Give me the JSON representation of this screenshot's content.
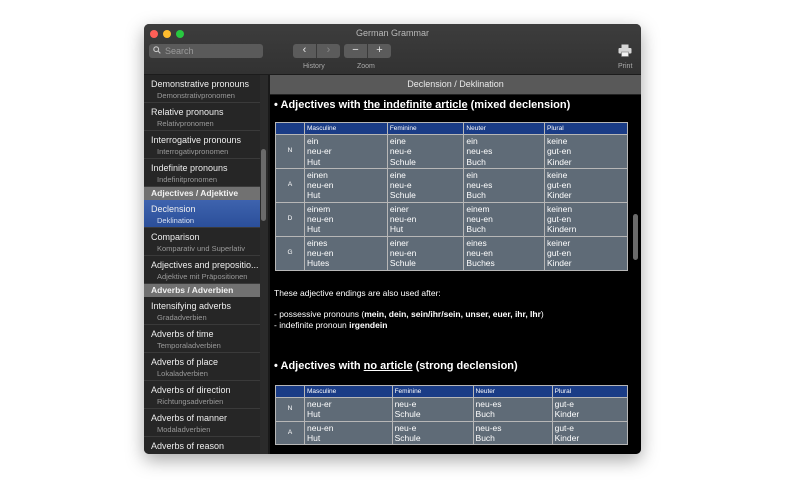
{
  "window": {
    "title": "German Grammar",
    "toolbar": {
      "search_placeholder": "Search",
      "history_label": "History",
      "zoom_label": "Zoom",
      "print_label": "Print",
      "back_glyph": "‹",
      "forward_glyph": "›",
      "zoom_out_glyph": "−",
      "zoom_in_glyph": "+"
    }
  },
  "sidebar": {
    "items": [
      {
        "type": "item",
        "title": "Demonstrative pronouns",
        "subtitle": "Demonstrativpronomen"
      },
      {
        "type": "item",
        "title": "Relative pronouns",
        "subtitle": "Relativpronomen"
      },
      {
        "type": "item",
        "title": "Interrogative pronouns",
        "subtitle": "Interrogativpronomen"
      },
      {
        "type": "item",
        "title": "Indefinite pronouns",
        "subtitle": "Indefinitpronomen"
      },
      {
        "type": "header",
        "title": "Adjectives / Adjektive"
      },
      {
        "type": "item",
        "title": "Declension",
        "subtitle": "Deklination",
        "selected": true
      },
      {
        "type": "item",
        "title": "Comparison",
        "subtitle": "Komparativ und Superlativ"
      },
      {
        "type": "item",
        "title": "Adjectives and prepositio...",
        "subtitle": "Adjektive mit Präpositionen"
      },
      {
        "type": "header",
        "title": "Adverbs / Adverbien"
      },
      {
        "type": "item",
        "title": "Intensifying adverbs",
        "subtitle": "Gradadverbien"
      },
      {
        "type": "item",
        "title": "Adverbs of time",
        "subtitle": "Temporaladverbien"
      },
      {
        "type": "item",
        "title": "Adverbs of place",
        "subtitle": "Lokaladverbien"
      },
      {
        "type": "item",
        "title": "Adverbs of direction",
        "subtitle": "Richtungsadverbien"
      },
      {
        "type": "item",
        "title": "Adverbs of manner",
        "subtitle": "Modaladverbien"
      },
      {
        "type": "item",
        "title": "Adverbs of reason",
        "subtitle": ""
      }
    ]
  },
  "content": {
    "header": "Declension / Deklination",
    "section1": {
      "bullet": "•",
      "pre": "Adjectives with ",
      "underlined": "the indefinite article",
      "post": " (mixed declension)"
    },
    "section2": {
      "bullet": "•",
      "pre": "Adjectives with ",
      "underlined": "no article",
      "post": " (strong declension)"
    },
    "table_headers": [
      "Masculine",
      "Feminine",
      "Neuter",
      "Plural"
    ],
    "table1": [
      {
        "case": "N",
        "cells": [
          [
            "ein",
            "neu-er",
            "Hut"
          ],
          [
            "eine",
            "neu-e",
            "Schule"
          ],
          [
            "ein",
            "neu-es",
            "Buch"
          ],
          [
            "keine",
            "gut-en",
            "Kinder"
          ]
        ]
      },
      {
        "case": "A",
        "cells": [
          [
            "einen",
            "neu-en",
            "Hut"
          ],
          [
            "eine",
            "neu-e",
            "Schule"
          ],
          [
            "ein",
            "neu-es",
            "Buch"
          ],
          [
            "keine",
            "gut-en",
            "Kinder"
          ]
        ]
      },
      {
        "case": "D",
        "cells": [
          [
            "einem",
            "neu-en",
            "Hut"
          ],
          [
            "einer",
            "neu-en",
            "Hut"
          ],
          [
            "einem",
            "neu-en",
            "Buch"
          ],
          [
            "keinen",
            "gut-en",
            "Kindern"
          ]
        ]
      },
      {
        "case": "G",
        "cells": [
          [
            "eines",
            "neu-en",
            "Hutes"
          ],
          [
            "einer",
            "neu-en",
            "Schule"
          ],
          [
            "eines",
            "neu-en",
            "Buches"
          ],
          [
            "keiner",
            "gut-en",
            "Kinder"
          ]
        ]
      }
    ],
    "info": {
      "intro": "These adjective endings are also used after:",
      "line1_pre": "- possessive pronouns (",
      "line1_bold": "mein, dein, sein/ihr/sein, unser, euer, ihr, Ihr",
      "line1_post": ")",
      "line2_pre": "- indefinite pronoun ",
      "line2_bold": "irgendein"
    },
    "table2": [
      {
        "case": "N",
        "cells": [
          [
            "neu-er",
            "Hut"
          ],
          [
            "neu-e",
            "Schule"
          ],
          [
            "neu-es",
            "Buch"
          ],
          [
            "gut-e",
            "Kinder"
          ]
        ]
      },
      {
        "case": "A",
        "cells": [
          [
            "neu-en",
            "Hut"
          ],
          [
            "neu-e",
            "Schule"
          ],
          [
            "neu-es",
            "Buch"
          ],
          [
            "gut-e",
            "Kinder"
          ]
        ]
      }
    ]
  }
}
